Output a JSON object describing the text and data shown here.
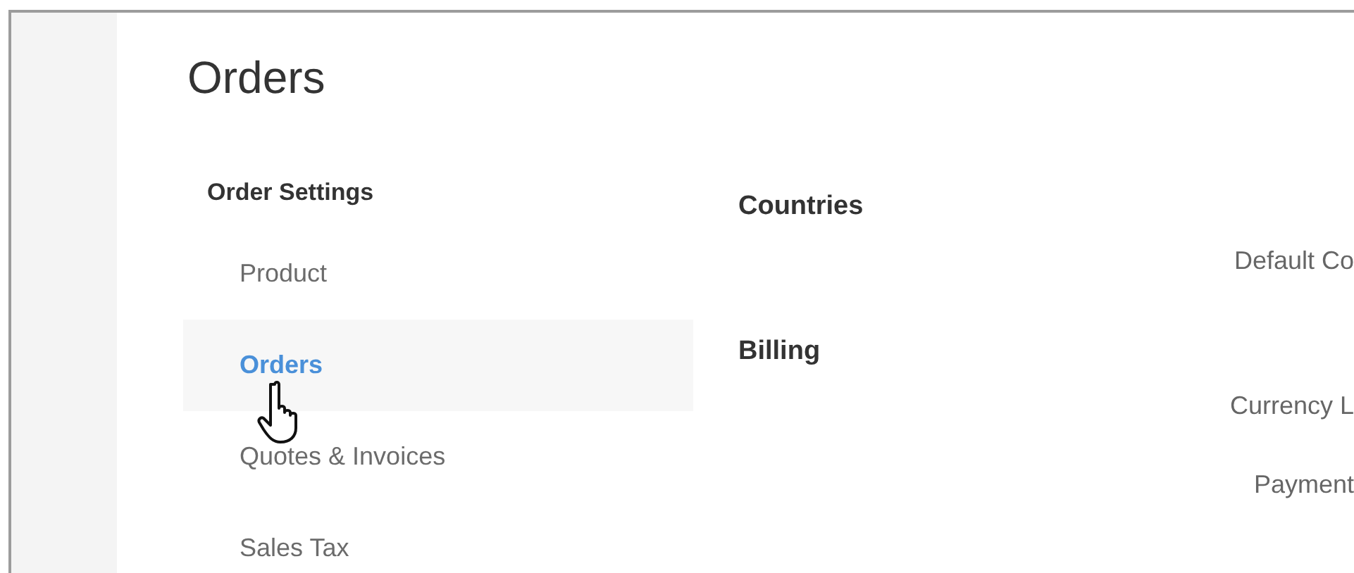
{
  "page": {
    "title": "Orders"
  },
  "sidebar": {
    "heading": "Order Settings",
    "items": [
      {
        "label": "Product",
        "selected": false
      },
      {
        "label": "Orders",
        "selected": true
      },
      {
        "label": "Quotes & Invoices",
        "selected": false
      },
      {
        "label": "Sales Tax",
        "selected": false
      }
    ]
  },
  "sections": [
    {
      "heading": "Countries",
      "fields": [
        "Default Co"
      ]
    },
    {
      "heading": "Billing",
      "fields": [
        "Currency L",
        "Payment"
      ]
    }
  ]
}
